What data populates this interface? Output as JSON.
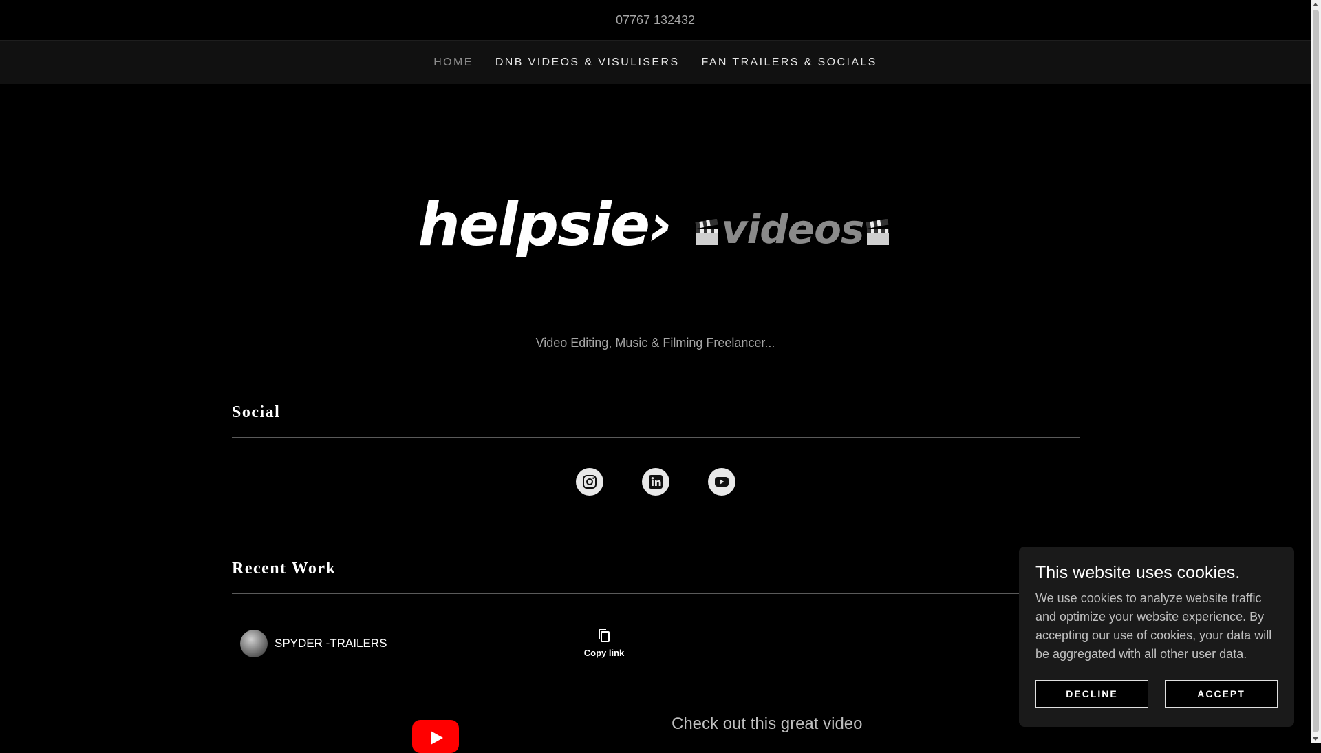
{
  "topbar": {
    "phone": "07767 132432"
  },
  "nav": {
    "items": [
      {
        "label": "HOME",
        "active": true
      },
      {
        "label": "DNB VIDEOS & VISULISERS",
        "active": false
      },
      {
        "label": "FAN TRAILERS & SOCIALS",
        "active": false
      }
    ]
  },
  "hero": {
    "logo_word1": "helpsie›",
    "logo_word2": "videos",
    "tagline": "Video Editing, Music & Filming Freelancer..."
  },
  "social": {
    "title": "Social",
    "icons": [
      "instagram-icon",
      "linkedin-icon",
      "youtube-icon"
    ]
  },
  "recent_work": {
    "title": "Recent Work",
    "channel_name": "SPYDER -TRAILERS",
    "copy_label": "Copy link",
    "video_caption": "Check out this great video"
  },
  "cookie": {
    "title": "This website uses cookies.",
    "body": "We use cookies to analyze website traffic and optimize your website experience. By accepting our use of cookies, your data will be aggregated with all other user data.",
    "decline": "DECLINE",
    "accept": "ACCEPT"
  },
  "colors": {
    "background": "#000000",
    "nav_bg": "#111111",
    "youtube_red": "#ff0000"
  }
}
